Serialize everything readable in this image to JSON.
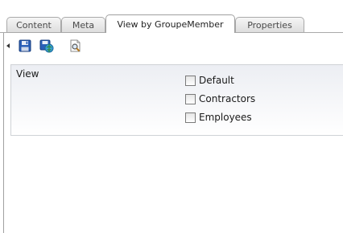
{
  "tabs": [
    {
      "label": "Content",
      "active": false
    },
    {
      "label": "Meta",
      "active": false
    },
    {
      "label": "View by GroupeMember",
      "active": true
    },
    {
      "label": "Properties",
      "active": false
    }
  ],
  "toolbar": {
    "buttons": [
      {
        "icon": "save-icon"
      },
      {
        "icon": "save-and-publish-icon"
      },
      {
        "icon": "preview-icon"
      }
    ]
  },
  "panel": {
    "title": "View",
    "options": [
      {
        "label": "Default",
        "checked": false
      },
      {
        "label": "Contractors",
        "checked": false
      },
      {
        "label": "Employees",
        "checked": false
      }
    ]
  }
}
